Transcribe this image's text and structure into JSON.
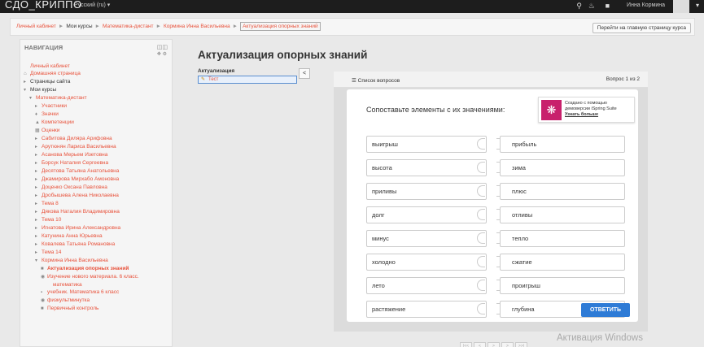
{
  "navbar": {
    "brand": "СДО_КРИППО",
    "language": "Русский (ru) ▾",
    "user_name": "Инна Кормина",
    "caret": "▾"
  },
  "breadcrumb": {
    "items": [
      "Личный кабинет",
      "Мои курсы",
      "Математика-дистант",
      "Кормина Инна Васильевна",
      "Актуализация опорных знаний"
    ],
    "home_button": "Перейти на главную страницу курса"
  },
  "navigation": {
    "title": "НАВИГАЦИЯ",
    "items": [
      {
        "label": "Личный кабинет",
        "style": "o",
        "indent": 0,
        "icon": ""
      },
      {
        "label": "Домашняя страница",
        "style": "o",
        "indent": 0,
        "icon": "⌂"
      },
      {
        "label": "Страницы сайта",
        "style": "b",
        "indent": 0,
        "icon": "▸"
      },
      {
        "label": "Мои курсы",
        "style": "b",
        "indent": 0,
        "icon": "▾"
      },
      {
        "label": "Математика-дистант",
        "style": "o",
        "indent": 1,
        "icon": "▾"
      },
      {
        "label": "Участники",
        "style": "o",
        "indent": 2,
        "icon": "▸"
      },
      {
        "label": "Значки",
        "style": "o",
        "indent": 2,
        "icon": "♦"
      },
      {
        "label": "Компетенции",
        "style": "o",
        "indent": 2,
        "icon": "▲"
      },
      {
        "label": "Оценки",
        "style": "o",
        "indent": 2,
        "icon": "▦"
      },
      {
        "label": "Сабитова Диляра Арифовна",
        "style": "o",
        "indent": 2,
        "icon": "▸"
      },
      {
        "label": "Арутюнян Лариса Васильевна",
        "style": "o",
        "indent": 2,
        "icon": "▸"
      },
      {
        "label": "Асанова Мерьем Изетовна",
        "style": "o",
        "indent": 2,
        "icon": "▸"
      },
      {
        "label": "Борсук Наталия Сергеевна",
        "style": "o",
        "indent": 2,
        "icon": "▸"
      },
      {
        "label": "Десятова Татьяна Анатольевна",
        "style": "o",
        "indent": 2,
        "icon": "▸"
      },
      {
        "label": "Джамирова Мирхабо Амоновна",
        "style": "o",
        "indent": 2,
        "icon": "▸"
      },
      {
        "label": "Доценко Оксана Павловна",
        "style": "o",
        "indent": 2,
        "icon": "▸"
      },
      {
        "label": "Дробышева Алена Николаевна",
        "style": "o",
        "indent": 2,
        "icon": "▸"
      },
      {
        "label": "Тема 8",
        "style": "o",
        "indent": 2,
        "icon": "▸"
      },
      {
        "label": "Дякова Наталия Владимировна",
        "style": "o",
        "indent": 2,
        "icon": "▸"
      },
      {
        "label": "Тема 10",
        "style": "o",
        "indent": 2,
        "icon": "▸"
      },
      {
        "label": "Игнатова Ирина Александровна",
        "style": "o",
        "indent": 2,
        "icon": "▸"
      },
      {
        "label": "Катунина Анна Юрьевна",
        "style": "o",
        "indent": 2,
        "icon": "▸"
      },
      {
        "label": "Ковалева Татьяна Романовна",
        "style": "o",
        "indent": 2,
        "icon": "▸"
      },
      {
        "label": "Тема 14",
        "style": "o",
        "indent": 2,
        "icon": "▸"
      },
      {
        "label": "Кормина Инна Васильевна",
        "style": "o",
        "indent": 2,
        "icon": "▾"
      },
      {
        "label": "Актуализация опорных знаний",
        "style": "sel",
        "indent": 3,
        "icon": "■"
      },
      {
        "label": "Изучение нового материала. 6 класс.",
        "style": "o",
        "indent": 3,
        "icon": "◉"
      },
      {
        "label": "математика",
        "style": "o",
        "indent": 4,
        "icon": ""
      },
      {
        "label": "учебник. Математика 6 класс",
        "style": "o",
        "indent": 3,
        "icon": "▪"
      },
      {
        "label": "физкультминутка",
        "style": "o",
        "indent": 3,
        "icon": "◉"
      },
      {
        "label": "Первичный контроль",
        "style": "o",
        "indent": 3,
        "icon": "■"
      }
    ]
  },
  "main": {
    "title": "Актуализация опорных знаний",
    "toc_label": "Актуализация",
    "toc_item": "Тест",
    "collapse": "<"
  },
  "player": {
    "question_list": "☰ Список вопросов",
    "question_count": "Вопрос 1 из 2",
    "question_title": "Сопоставьте элементы с их значениями:",
    "promo_line1": "Создано с помощью",
    "promo_line2": "демоверсии iSpring Suite",
    "promo_link": "Узнать больше",
    "answer_button": "ОТВЕТИТЬ",
    "pairs": [
      {
        "left": "выигрыш",
        "right": "прибыль"
      },
      {
        "left": "высота",
        "right": "зима"
      },
      {
        "left": "приливы",
        "right": "плюс"
      },
      {
        "left": "долг",
        "right": "отливы"
      },
      {
        "left": "минус",
        "right": "тепло"
      },
      {
        "left": "холодно",
        "right": "сжатие"
      },
      {
        "left": "лето",
        "right": "проигрыш"
      },
      {
        "left": "растяжение",
        "right": "глубина"
      }
    ]
  },
  "pager": [
    "|<<",
    "<",
    ">",
    ">",
    ">>|"
  ],
  "watermark": "Активация Windows",
  "colors": {
    "accent": "#e8513a",
    "answer": "#2e7bd6",
    "promo": "#c8206c"
  }
}
